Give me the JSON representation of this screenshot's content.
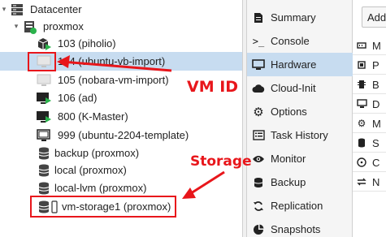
{
  "tree": {
    "datacenter": "Datacenter",
    "node": "proxmox",
    "items": [
      {
        "label": "103 (piholio)",
        "icon": "vm-running-icon"
      },
      {
        "label": "104 (ubuntu-vb-import)",
        "icon": "vm-stopped-icon"
      },
      {
        "label": "105 (nobara-vm-import)",
        "icon": "vm-stopped-icon"
      },
      {
        "label": "106 (ad)",
        "icon": "vm-running-icon"
      },
      {
        "label": "800 (K-Master)",
        "icon": "vm-running-icon"
      },
      {
        "label": "999 (ubuntu-2204-template)",
        "icon": "template-icon"
      },
      {
        "label": "backup (proxmox)",
        "icon": "storage-icon"
      },
      {
        "label": "local (proxmox)",
        "icon": "storage-icon"
      },
      {
        "label": "local-lvm (proxmox)",
        "icon": "storage-icon"
      },
      {
        "label": "vm-storage1 (proxmox)",
        "icon": "storage-icon"
      }
    ]
  },
  "menu": {
    "items": [
      {
        "label": "Summary",
        "icon": "summary-icon"
      },
      {
        "label": "Console",
        "icon": "console-icon"
      },
      {
        "label": "Hardware",
        "icon": "monitor-icon"
      },
      {
        "label": "Cloud-Init",
        "icon": "cloud-icon"
      },
      {
        "label": "Options",
        "icon": "gear-icon"
      },
      {
        "label": "Task History",
        "icon": "list-icon"
      },
      {
        "label": "Monitor",
        "icon": "eye-icon"
      },
      {
        "label": "Backup",
        "icon": "backup-icon"
      },
      {
        "label": "Replication",
        "icon": "replication-icon"
      },
      {
        "label": "Snapshots",
        "icon": "snapshot-icon"
      }
    ],
    "active": "Hardware"
  },
  "content": {
    "add_button": "Add",
    "rows": [
      "M",
      "P",
      "B",
      "D",
      "M",
      "S",
      "C",
      "N"
    ]
  },
  "annotations": {
    "vmid_label": "VM ID",
    "storage_label": "Storage",
    "color": "#e8161b"
  },
  "colors": {
    "selection": "#c7dcf0",
    "running": "#2bb24c"
  }
}
